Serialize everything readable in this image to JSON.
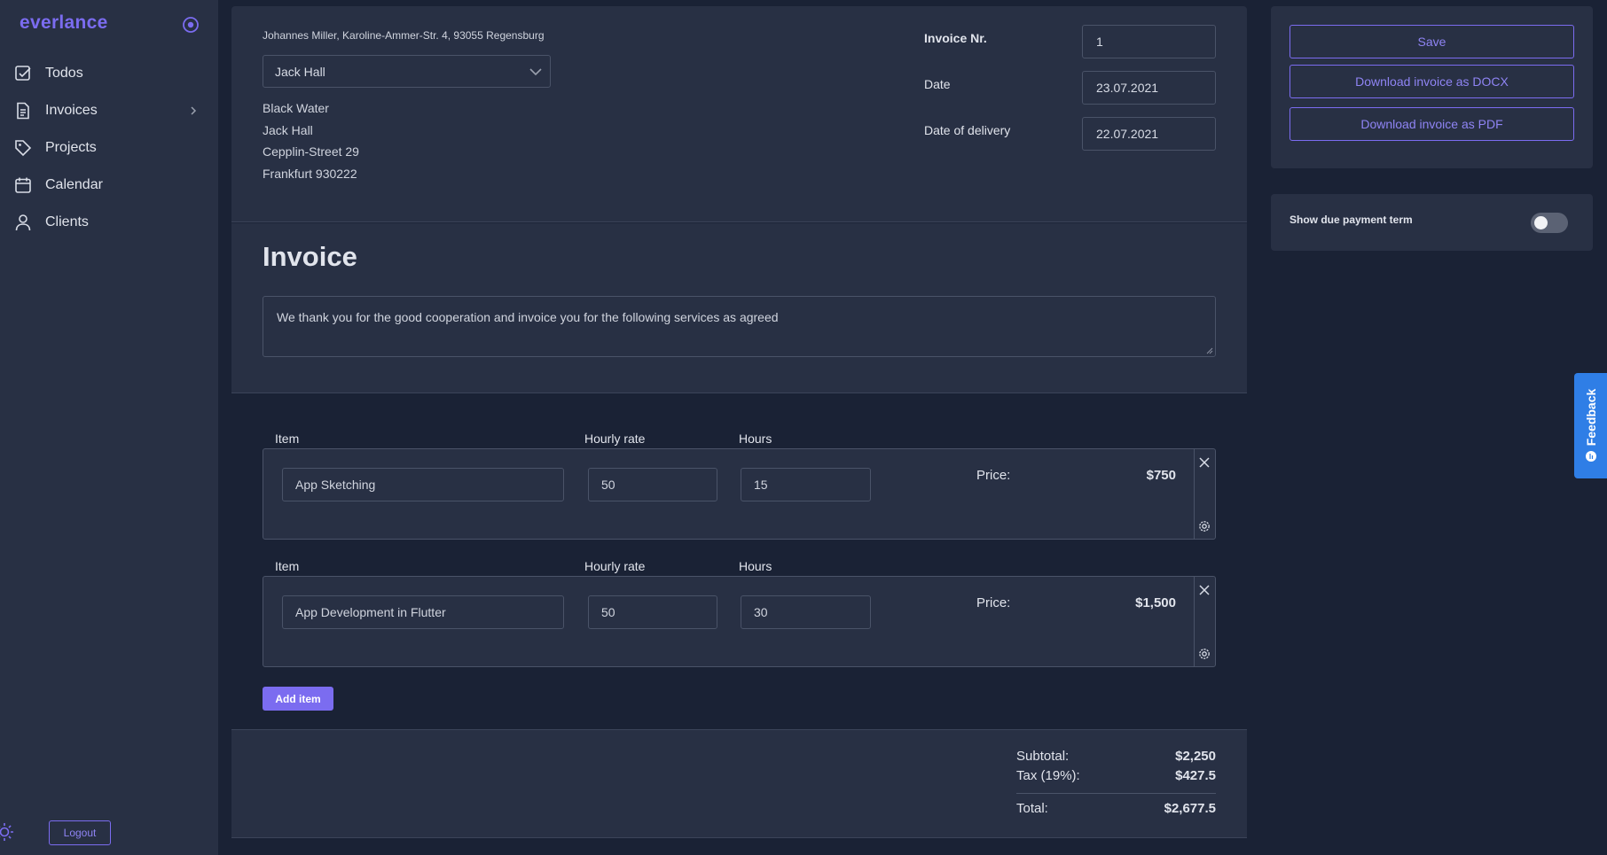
{
  "app": {
    "brand": "everlance"
  },
  "sidebar": {
    "items": [
      {
        "label": "Todos",
        "icon": "checkbox-icon"
      },
      {
        "label": "Invoices",
        "icon": "document-icon"
      },
      {
        "label": "Projects",
        "icon": "tag-icon"
      },
      {
        "label": "Calendar",
        "icon": "calendar-icon"
      },
      {
        "label": "Clients",
        "icon": "user-icon"
      }
    ],
    "logout_label": "Logout"
  },
  "invoice": {
    "sender": "Johannes Miller, Karoline-Ammer-Str. 4, 93055 Regensburg",
    "client_selected": "Jack Hall",
    "client_address": [
      "Black Water",
      "Jack Hall",
      "Cepplin-Street 29",
      "Frankfurt 930222"
    ],
    "number_label": "Invoice Nr.",
    "number_value": "1",
    "date_label": "Date",
    "date_value": "23.07.2021",
    "delivery_label": "Date of delivery",
    "delivery_value": "22.07.2021",
    "title": "Invoice",
    "intro_text": "We thank you for the good cooperation and invoice you for the following services as agreed"
  },
  "items": {
    "col_item": "Item",
    "col_rate": "Hourly rate",
    "col_hours": "Hours",
    "price_label": "Price:",
    "rows": [
      {
        "name": "App Sketching",
        "rate": "50",
        "hours": "15",
        "price": "$750"
      },
      {
        "name": "App Development in Flutter",
        "rate": "50",
        "hours": "30",
        "price": "$1,500"
      }
    ],
    "add_label": "Add item"
  },
  "totals": {
    "subtotal_label": "Subtotal:",
    "subtotal": "$2,250",
    "tax_label": "Tax (19%):",
    "tax": "$427.5",
    "total_label": "Total:",
    "total": "$2,677.5"
  },
  "actions": {
    "save": "Save",
    "docx": "Download invoice as DOCX",
    "pdf": "Download invoice as PDF"
  },
  "terms": {
    "label": "Show due payment term",
    "enabled": false
  },
  "feedback": {
    "label": "Feedback"
  },
  "colors": {
    "accent": "#7b6cf0",
    "panel": "#283044",
    "background": "#1a2235",
    "feedback": "#2f7ee6"
  }
}
